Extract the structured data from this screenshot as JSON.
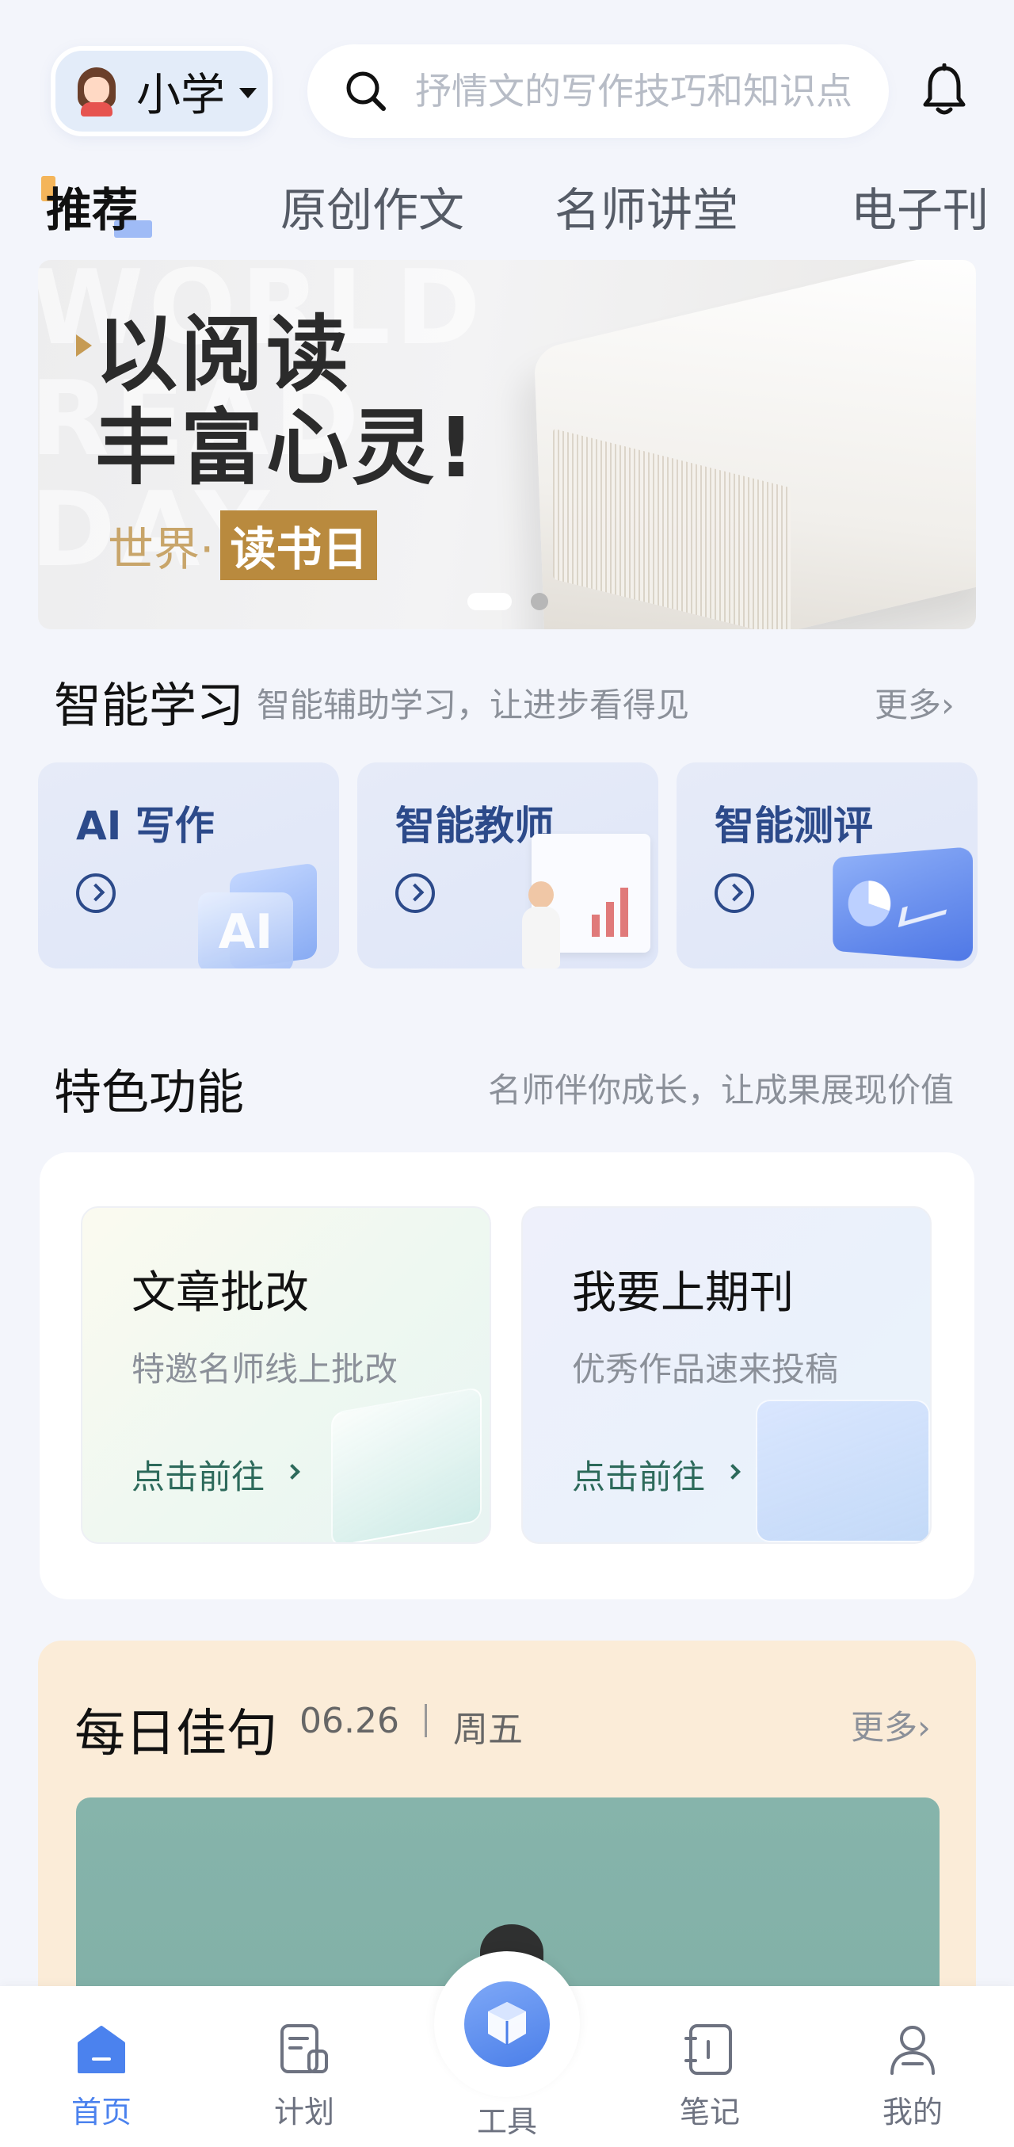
{
  "header": {
    "grade": "小学",
    "search_placeholder": "抒情文的写作技巧和知识点"
  },
  "tabs": [
    "推荐",
    "原创作文",
    "名师讲堂",
    "电子刊"
  ],
  "banner": {
    "line1": "以阅读",
    "line2": "丰富心灵!",
    "sub_prefix": "世界·",
    "sub_highlight": "读书日",
    "ghost_text": "WORLD READ DAY"
  },
  "smart_learning": {
    "title": "智能学习",
    "subtitle": "智能辅助学习，让进步看得见",
    "more": "更多›",
    "cards": [
      {
        "label": "AI 写作",
        "deco": "AI"
      },
      {
        "label": "智能教师"
      },
      {
        "label": "智能测评"
      }
    ]
  },
  "features": {
    "title": "特色功能",
    "subtitle": "名师伴你成长，让成果展现价值",
    "cards": [
      {
        "title": "文章批改",
        "desc": "特邀名师线上批改",
        "action": "点击前往"
      },
      {
        "title": "我要上期刊",
        "desc": "优秀作品速来投稿",
        "action": "点击前往"
      }
    ]
  },
  "daily_quote": {
    "title": "每日佳句",
    "date": "06.26",
    "weekday": "周五",
    "more": "更多›"
  },
  "bottom_nav": [
    {
      "label": "首页",
      "icon": "home-icon",
      "active": true
    },
    {
      "label": "计划",
      "icon": "plan-icon"
    },
    {
      "label": "工具",
      "icon": "tools-cube-icon"
    },
    {
      "label": "笔记",
      "icon": "notes-icon"
    },
    {
      "label": "我的",
      "icon": "profile-icon"
    }
  ],
  "colors": {
    "accent": "#4b82ee",
    "feature_action": "#2d6a5b",
    "page_bg": "#f3f5fb",
    "quote_bg": "#fbecd8"
  }
}
